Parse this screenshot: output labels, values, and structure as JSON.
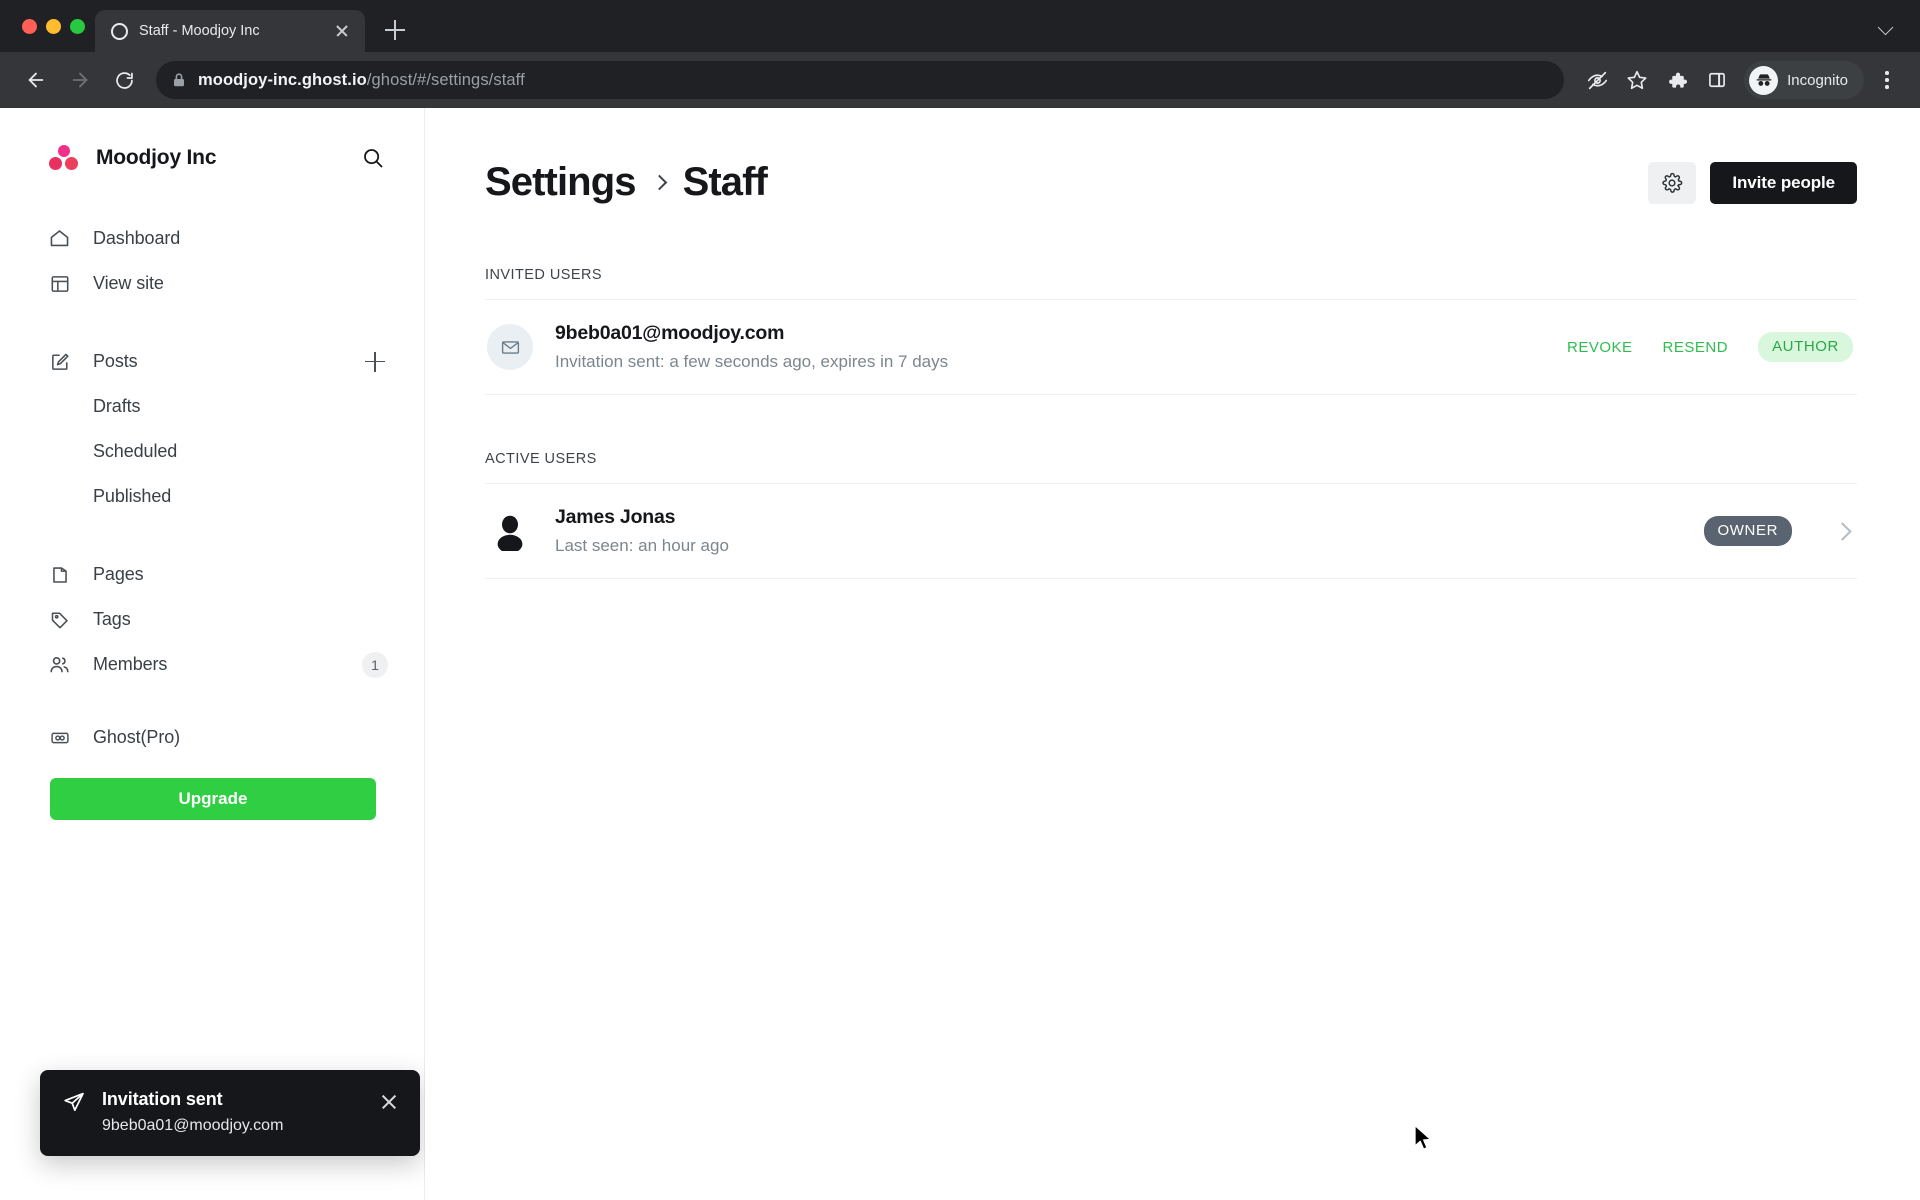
{
  "browser": {
    "tab": {
      "title": "Staff - Moodjoy Inc",
      "favicon": "ghost-ring-icon"
    },
    "new_tab_label": "+",
    "url": {
      "host": "moodjoy-inc.ghost.io",
      "path": "/ghost/#/settings/staff"
    },
    "toolbar_icons": [
      "back-icon",
      "forward-icon",
      "reload-icon",
      "lock-icon",
      "eye-slash-icon",
      "star-icon",
      "extensions-puzzle-icon",
      "side-panel-icon"
    ],
    "profile": {
      "label": "Incognito",
      "icon": "incognito-avatar-icon"
    },
    "menu_icon": "kebab-menu-icon"
  },
  "sidebar": {
    "brand": {
      "name": "Moodjoy Inc",
      "logo": "moodjoy-dots-logo",
      "search_icon": "search-icon"
    },
    "primary": [
      {
        "label": "Dashboard",
        "icon": "home-icon"
      },
      {
        "label": "View site",
        "icon": "layout-icon"
      }
    ],
    "posts": {
      "label": "Posts",
      "icon": "edit-square-icon",
      "add_icon": "plus-icon"
    },
    "posts_sub": [
      {
        "label": "Drafts"
      },
      {
        "label": "Scheduled"
      },
      {
        "label": "Published"
      }
    ],
    "secondary": [
      {
        "label": "Pages",
        "icon": "pages-icon",
        "count": ""
      },
      {
        "label": "Tags",
        "icon": "tag-icon",
        "count": ""
      },
      {
        "label": "Members",
        "icon": "members-icon",
        "count": "1"
      }
    ],
    "ghost_pro": {
      "label": "Ghost(Pro)",
      "icon": "ghost-pro-icon"
    },
    "upgrade_label": "Upgrade",
    "upgrade_color": "#30CF43"
  },
  "toast": {
    "icon": "send-paper-plane-icon",
    "title": "Invitation sent",
    "subtitle": "9beb0a01@moodjoy.com",
    "close_icon": "close-icon"
  },
  "main": {
    "breadcrumb": {
      "parent": "Settings",
      "current": "Staff",
      "separator_icon": "chevron-right-icon"
    },
    "settings_gear_icon": "gear-icon",
    "invite_label": "Invite people",
    "invited_section": {
      "title": "INVITED USERS",
      "rows": [
        {
          "icon": "envelope-icon",
          "email": "9beb0a01@moodjoy.com",
          "status": "Invitation sent: a few seconds ago, expires in 7 days",
          "revoke_label": "REVOKE",
          "resend_label": "RESEND",
          "role": "AUTHOR"
        }
      ]
    },
    "active_section": {
      "title": "ACTIVE USERS",
      "rows": [
        {
          "icon": "person-avatar-icon",
          "name": "James Jonas",
          "status": "Last seen: an hour ago",
          "role": "OWNER",
          "chevron_icon": "chevron-right-icon"
        }
      ]
    }
  },
  "colors": {
    "accent_green": "#30CF43",
    "link_green": "#30BD4E",
    "author_badge_bg": "#D9F7DD",
    "owner_badge_bg": "#5A6470",
    "dark": "#15171A"
  }
}
